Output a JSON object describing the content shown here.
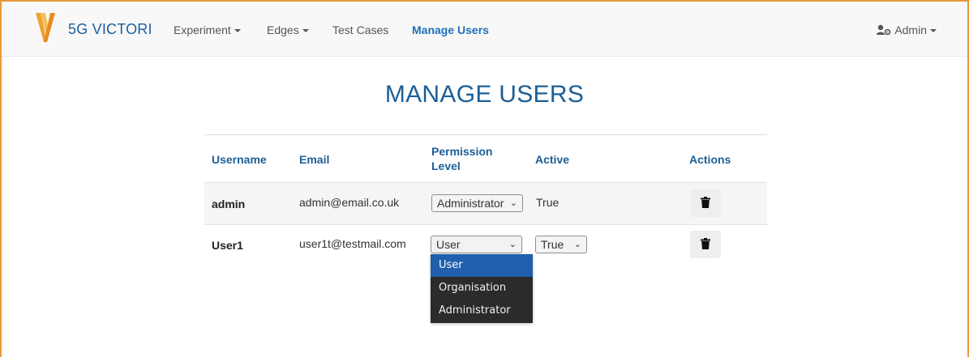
{
  "navbar": {
    "brand": "5G VICTORI",
    "items": [
      {
        "label": "Experiment",
        "has_caret": true
      },
      {
        "label": "Edges",
        "has_caret": true
      },
      {
        "label": "Test Cases",
        "has_caret": false
      },
      {
        "label": "Manage Users",
        "has_caret": false,
        "active": true
      }
    ],
    "user_menu": {
      "label": "Admin",
      "icon": "user-cog-icon"
    }
  },
  "page": {
    "title": "MANAGE USERS"
  },
  "table": {
    "headers": {
      "username": "Username",
      "email": "Email",
      "permission_line1": "Permission",
      "permission_line2": "Level",
      "active": "Active",
      "actions": "Actions"
    },
    "rows": [
      {
        "username": "admin",
        "email": "admin@email.co.uk",
        "permission": "Administrator",
        "active": "True",
        "action_icon": "trash-icon"
      },
      {
        "username": "User1",
        "email": "user1t@testmail.com",
        "permission": "User",
        "active": "True",
        "action_icon": "trash-icon"
      }
    ]
  },
  "permission_dropdown": {
    "options": [
      "User",
      "Organisation",
      "Administrator"
    ],
    "highlighted": "User"
  },
  "colors": {
    "accent": "#1c5f96",
    "frame": "#e89a3c",
    "dropdown_bg": "#2b2b2b",
    "dropdown_highlight": "#1f5fad"
  }
}
